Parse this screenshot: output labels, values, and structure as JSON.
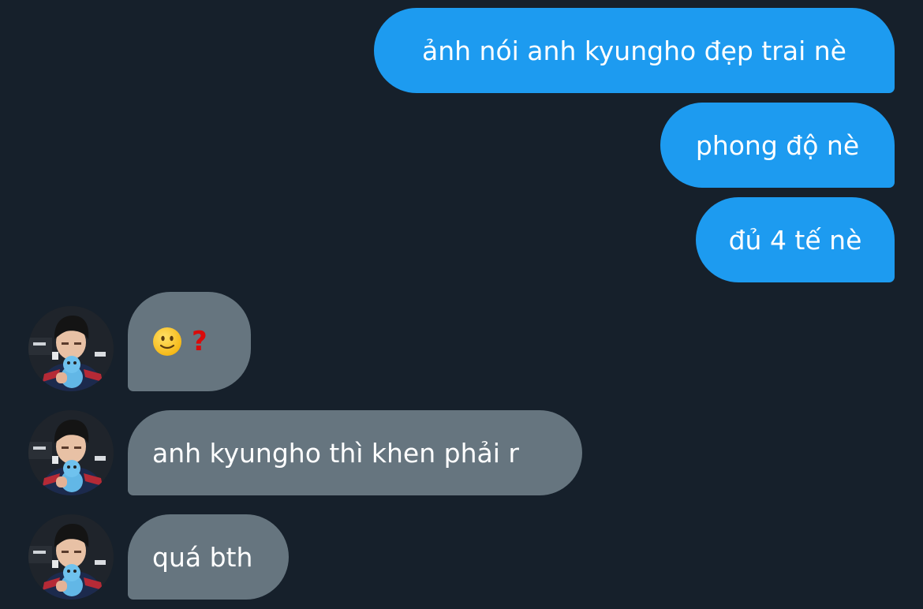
{
  "conversation": {
    "messages": [
      {
        "direction": "outgoing",
        "text": "ảnh nói anh kyungho đẹp trai nè"
      },
      {
        "direction": "outgoing",
        "text": "phong độ nè"
      },
      {
        "direction": "outgoing",
        "text": "đủ 4 tế nè"
      },
      {
        "direction": "incoming",
        "emoji": [
          "slightly-smiling-face-icon",
          "red-question-mark-icon"
        ],
        "text": ""
      },
      {
        "direction": "incoming",
        "text": "anh kyungho thì khen phải r"
      },
      {
        "direction": "incoming",
        "text": "quá bth"
      }
    ]
  },
  "colors": {
    "background": "#16202b",
    "outgoing_bubble": "#1d9bf0",
    "incoming_bubble": "#66757f",
    "question_mark": "#d90b0b"
  }
}
